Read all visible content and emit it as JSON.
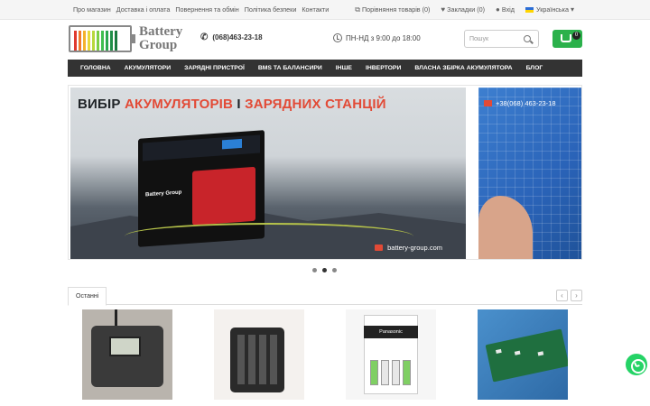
{
  "topbar": {
    "links": [
      "Про магазин",
      "Доставка і оплата",
      "Повернення та обмін",
      "Політика безпеки",
      "Контакти"
    ],
    "compare": "Порівняння товарів (0)",
    "bookmarks": "Закладки (0)",
    "login": "Вхід",
    "language": "Українська"
  },
  "header": {
    "logo_line1": "Battery",
    "logo_line2": "Group",
    "phone": "(068)463-23-18",
    "hours": "ПН-НД з 9:00 до 18:00",
    "search_placeholder": "Пошук",
    "cart_count": "0"
  },
  "nav": [
    "ГОЛОВНА",
    "АКУМУЛЯТОРИ",
    "ЗАРЯДНІ ПРИСТРОЇ",
    "BMS ТА БАЛАНСИРИ",
    "ІНШЕ",
    "ІНВЕРТОРИ",
    "ВЛАСНА ЗБІРКА АКУМУЛЯТОРА",
    "БЛОГ"
  ],
  "slider": {
    "headline_dark": "ВИБІР ",
    "headline_red": "АКУМУЛЯТОРІВ",
    "headline_mid": " І ",
    "headline_red2": "ЗАРЯДНИХ СТАНЦІЙ",
    "device_label": "Battery Group",
    "watermark": "battery-group.com",
    "slide2_phone": "+38(068) 463-23-18",
    "active_dot": 1
  },
  "latest": {
    "tab": "Останні",
    "prev": "‹",
    "next": "›",
    "p3_brand": "Panasonic"
  },
  "colors": {
    "nav_bg": "#333333",
    "cart_green": "#2bb14b",
    "accent_red": "#e24a36",
    "whatsapp": "#25d366"
  }
}
